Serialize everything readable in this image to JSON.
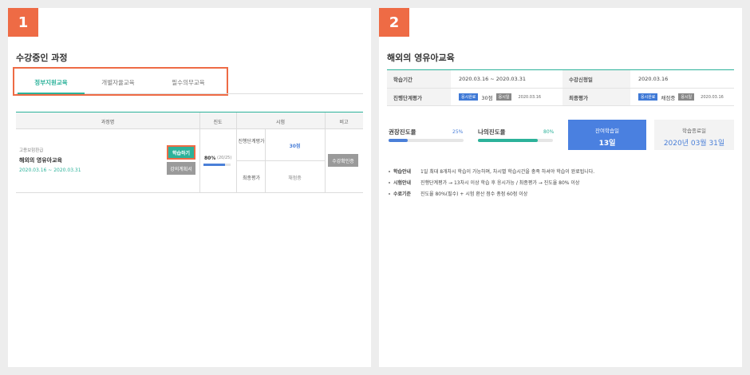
{
  "panel1": {
    "badge": "1",
    "title": "수강중인 과정",
    "tabs": [
      {
        "label": "정부지원교육"
      },
      {
        "label": "개별자율교육"
      },
      {
        "label": "필수의무교육"
      }
    ],
    "table": {
      "headers": [
        "과정명",
        "진도",
        "시험",
        "비고"
      ],
      "course_category": "고용보험환급",
      "course_name": "해외의 영유아교육",
      "course_period": "2020.03.16 ~ 2020.03.31",
      "study_button": "학습하기",
      "plan_button": "강의계획서",
      "progress_text": "80%",
      "progress_detail": "(20/25)",
      "progress_value": 0.8,
      "exam_rows": [
        {
          "label": "진행단계평가",
          "value": "30점"
        },
        {
          "label": "최종평가",
          "value": "채점중"
        }
      ],
      "confirm_button": "수강확인증"
    }
  },
  "panel2": {
    "badge": "2",
    "title": "해외의 영유아교육",
    "info": {
      "period_label": "학습기간",
      "period_value": "2020.03.16 ~ 2020.03.31",
      "apply_label": "수강신청일",
      "apply_value": "2020.03.16",
      "progress_eval_label": "진행단계평가",
      "progress_eval_chip1": "응시완료",
      "progress_eval_score": "30점",
      "progress_eval_chip2": "응시일",
      "progress_eval_date": "2020.03.16",
      "final_eval_label": "최종평가",
      "final_eval_chip1": "응시완료",
      "final_eval_status": "채점중",
      "final_eval_chip2": "응시일",
      "final_eval_date": "2020.03.16"
    },
    "stats": {
      "recommended_label": "권장진도율",
      "recommended_pct": "25%",
      "recommended_value": 0.25,
      "my_label": "나의진도율",
      "my_pct": "80%",
      "my_value": 0.8,
      "remaining_label": "잔여학습일",
      "remaining_value": "13일",
      "end_label": "학습종료일",
      "end_value": "2020년 03월 31일"
    },
    "notes": [
      {
        "label": "학습안내",
        "text": "1일 최대 8개차시 학습이 가능하며, 차시별 학습시간을 충족 하셔야 학습이 완료됩니다."
      },
      {
        "label": "시험안내",
        "text": "진행단계평가 → 13차시 이상 학습 후 응시가능 / 최종평가 → 진도율 80% 이상"
      },
      {
        "label": "수료기준",
        "text": "진도율 80%(필수) + 시험 환산 점수 총점 60점 이상"
      }
    ],
    "colors": {
      "accent": "#2cb29a",
      "blue": "#4a80e0",
      "highlight": "#ee6b45"
    }
  }
}
